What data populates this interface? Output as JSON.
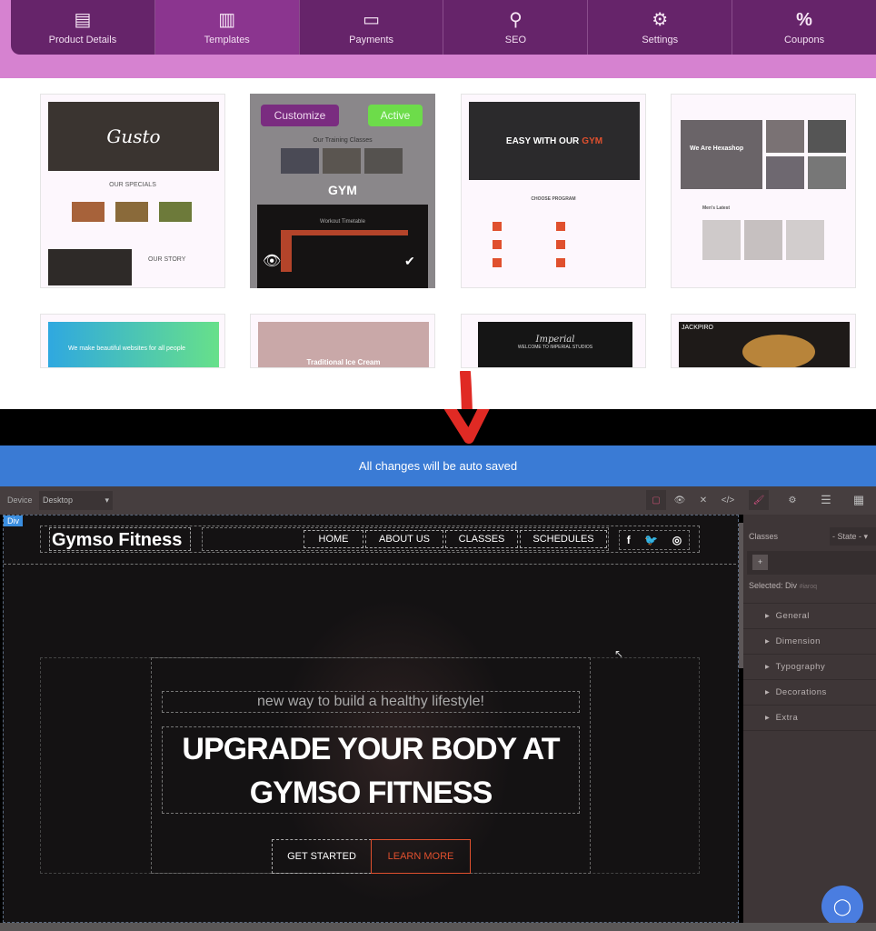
{
  "nav": {
    "items": [
      {
        "label": "Product Details",
        "icon": "clipboard-icon",
        "glyph": "📋"
      },
      {
        "label": "Templates",
        "icon": "layout-icon",
        "glyph": "▥"
      },
      {
        "label": "Payments",
        "icon": "payment-shield-icon",
        "glyph": "🛡"
      },
      {
        "label": "SEO",
        "icon": "seo-search-icon",
        "glyph": "🔍"
      },
      {
        "label": "Settings",
        "icon": "gear-icon",
        "glyph": "⚙"
      },
      {
        "label": "Coupons",
        "icon": "coupon-icon",
        "glyph": "%"
      }
    ],
    "active": "Templates"
  },
  "templates": [
    {
      "title": "Gusto",
      "section1": "OUR SPECIALS",
      "section2": "OUR STORY"
    },
    {
      "customize_label": "Customize",
      "active_label": "Active",
      "heading": "Our Training Classes",
      "name": "GYM",
      "timetable": "Workout Timetable"
    },
    {
      "headline_a": "EASY WITH OUR",
      "headline_b": "GYM",
      "section": "CHOOSE PROGRAM"
    },
    {
      "headline": "We Are Hexashop",
      "section": "Men's Latest"
    },
    {
      "headline": "We make beautiful websites for all people"
    },
    {
      "headline": "Traditional Ice Cream"
    },
    {
      "title": "Imperial",
      "subtitle": "WELCOME TO IMPERIAL STUDIOS"
    },
    {
      "title": "JACKPIRO"
    }
  ],
  "editor": {
    "autosave": "All changes will be auto saved",
    "device_label": "Device",
    "device_value": "Desktop",
    "badge": "Div",
    "site": {
      "brand": "Gymso Fitness",
      "menu": [
        "HOME",
        "ABOUT US",
        "CLASSES",
        "SCHEDULES"
      ],
      "social": [
        "f",
        "t",
        "ig"
      ],
      "tagline": "new way to build a healthy lifestyle!",
      "headline_1": "UPGRADE YOUR BODY AT",
      "headline_2": "GYMSO FITNESS",
      "cta_primary": "GET STARTED",
      "cta_secondary": "LEARN MORE"
    },
    "panel": {
      "classes_label": "Classes",
      "state_value": "- State -",
      "add": "+",
      "selected_label": "Selected:",
      "selected_value": "Div",
      "selected_id": "#iaroq",
      "sections": [
        "General",
        "Dimension",
        "Typography",
        "Decorations",
        "Extra"
      ]
    }
  },
  "colors": {
    "nav": "#66246a",
    "nav_active": "#8b358f",
    "autosave": "#3a7bd5",
    "accent": "#e0502e",
    "customize": "#7a2c80",
    "active": "#6ddc4a"
  }
}
